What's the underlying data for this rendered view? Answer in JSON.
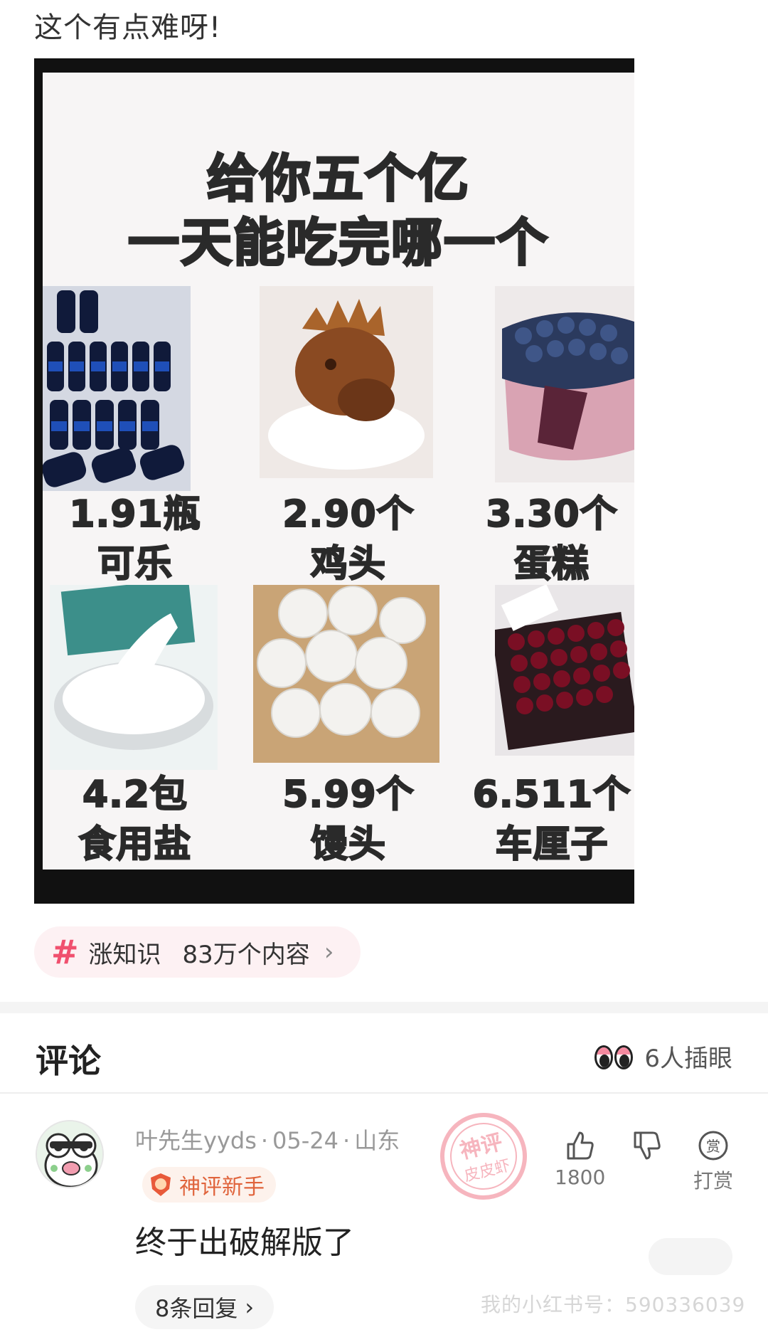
{
  "post": {
    "text": "这个有点难呀!"
  },
  "meme": {
    "title_line1": "给你五个亿",
    "title_line2": "一天能吃完哪一个",
    "items": [
      {
        "amount": "1.91瓶",
        "name": "可乐"
      },
      {
        "amount": "2.90个",
        "name": "鸡头"
      },
      {
        "amount": "3.30个",
        "name": "蛋糕"
      },
      {
        "amount": "4.2包",
        "name": "食用盐"
      },
      {
        "amount": "5.99个",
        "name": "馒头"
      },
      {
        "amount": "6.511个",
        "name": "车厘子"
      }
    ]
  },
  "topic": {
    "name": "涨知识",
    "count": "83万个内容",
    "chevron": "›"
  },
  "comments": {
    "title": "评论",
    "watchers": "6人插眼",
    "items": [
      {
        "user": "叶先生yyds",
        "date": "05-24",
        "location": "山东",
        "badge": "神评新手",
        "text": "终于出破解版了",
        "likes": "1800",
        "tip_label": "打赏",
        "tip_icon_char": "赏",
        "replies": "8条回复"
      }
    ]
  },
  "stamp": {
    "line1": "神评",
    "line2": "皮皮虾"
  },
  "watermark": {
    "text": "我的小红书号：590336039"
  },
  "colors": {
    "accent": "#f0506e",
    "badge": "#e0643c"
  }
}
